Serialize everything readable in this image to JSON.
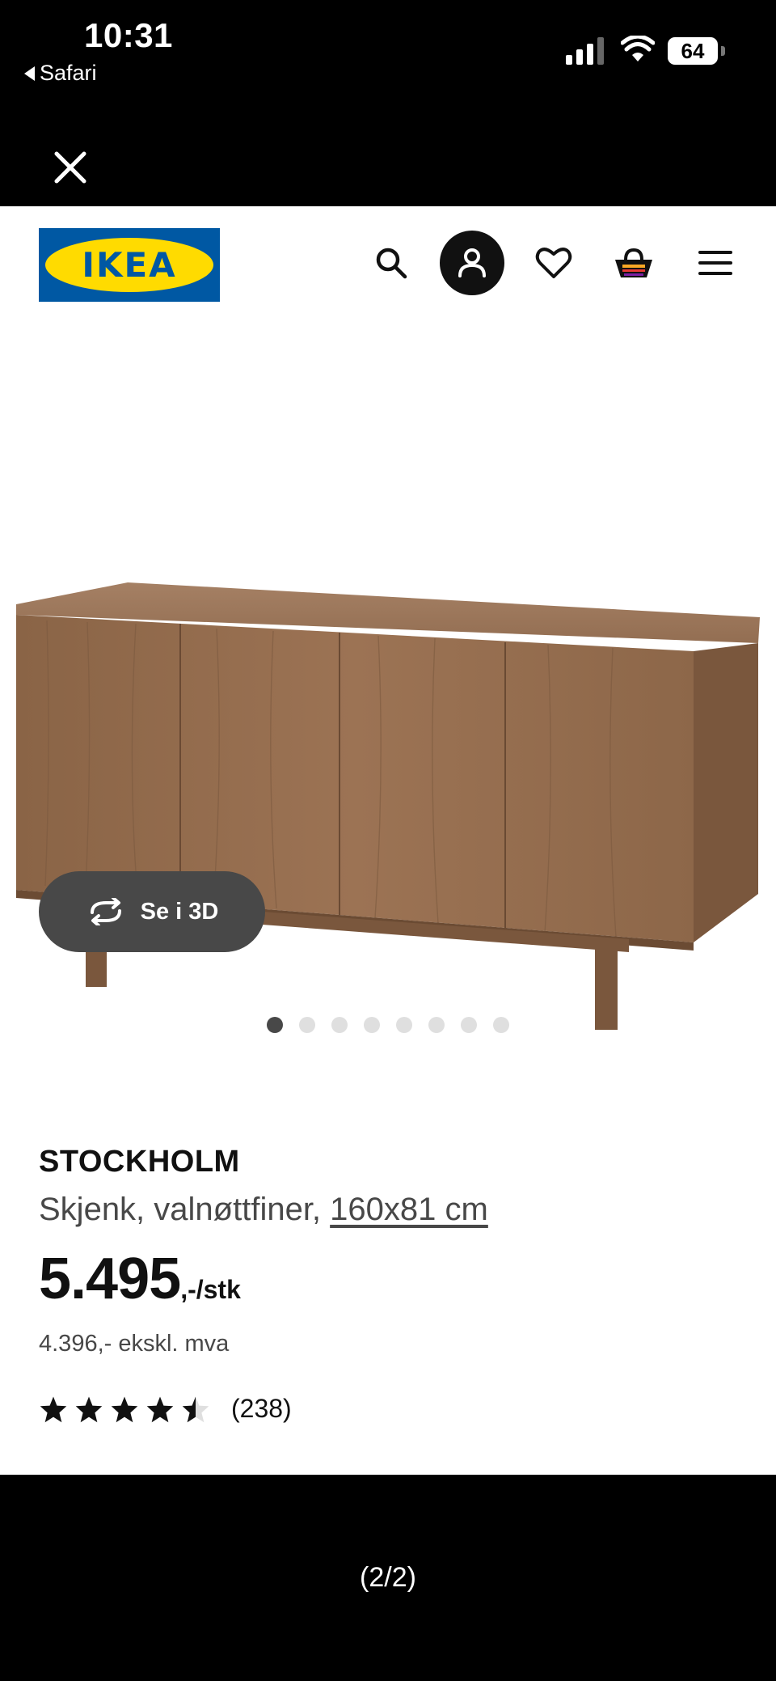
{
  "status_bar": {
    "time": "10:31",
    "back_app": "Safari",
    "battery": "64"
  },
  "header": {
    "logo_text": "IKEA",
    "brand_colors": {
      "blue": "#0058a3",
      "yellow": "#ffdb00"
    },
    "icons": [
      "search-icon",
      "profile-icon",
      "heart-icon",
      "basket-icon",
      "menu-icon"
    ]
  },
  "gallery": {
    "view_3d_label": "Se i 3D",
    "image_count": 8,
    "active_index": 0
  },
  "product": {
    "name": "STOCKHOLM",
    "description": "Skjenk, valnøttfiner, ",
    "size": "160x81 cm",
    "price": "5.495",
    "price_suffix": ",-/stk",
    "price_ex_vat": "4.396,- ekskl. mva",
    "rating": 4.5,
    "rating_count": "(238)"
  },
  "viewer": {
    "pager": "(2/2)"
  }
}
